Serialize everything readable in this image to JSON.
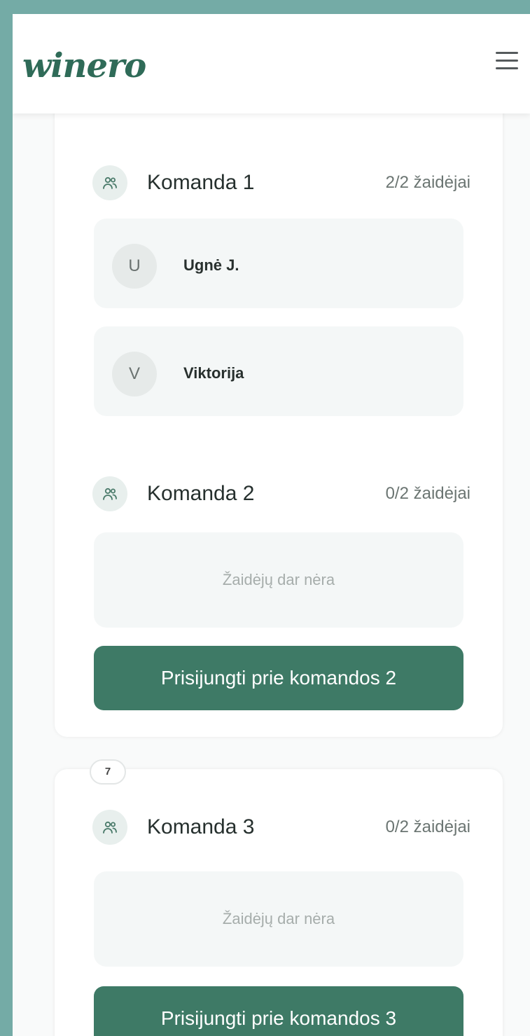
{
  "header": {
    "logo_text": "winero",
    "menu_icon": "hamburger-menu-icon"
  },
  "cards": [
    {
      "table_number": "",
      "teams": [
        {
          "name": "Komanda 1",
          "count": "2/2 žaidėjai",
          "players": [
            {
              "initial": "U",
              "name": "Ugnė J."
            },
            {
              "initial": "V",
              "name": "Viktorija"
            }
          ]
        },
        {
          "name": "Komanda 2",
          "count": "0/2 žaidėjai",
          "empty_text": "Žaidėjų dar nėra",
          "join_label": "Prisijungti prie komandos 2"
        }
      ]
    },
    {
      "table_number": "7",
      "teams": [
        {
          "name": "Komanda 3",
          "count": "0/2 žaidėjai",
          "empty_text": "Žaidėjų dar nėra",
          "join_label": "Prisijungti prie komandos 3"
        }
      ]
    }
  ],
  "colors": {
    "brand_green": "#2f6b58",
    "button_green": "#3e7a66",
    "page_background": "#74aba6"
  }
}
